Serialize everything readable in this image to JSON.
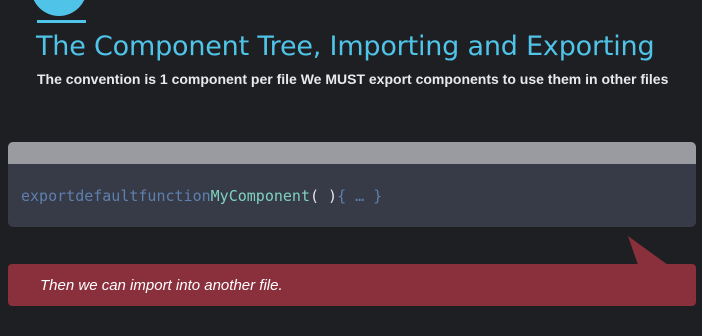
{
  "slide": {
    "title": "The Component Tree, Importing and Exporting",
    "subtitle": "The convention is 1 component per file  We MUST export components to use them in other files"
  },
  "code": {
    "kw_export": "export",
    "kw_default": "default",
    "kw_function": "function",
    "fn_name": "MyComponent",
    "parens": "( )",
    "body": "{ … }"
  },
  "callout": {
    "text": "Then we can import into another file."
  },
  "colors": {
    "background": "#1e1f22",
    "accent": "#4fc3e8",
    "callout": "#8a2f3c",
    "code_background": "#363b47",
    "code_header": "#9a9ba0"
  },
  "icons": {
    "logo": "circle-logo-icon"
  }
}
